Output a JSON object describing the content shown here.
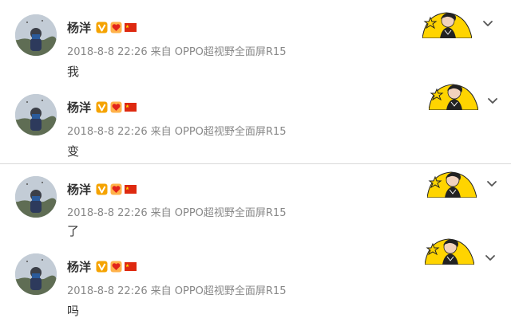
{
  "posts": [
    {
      "username": "杨洋",
      "timestamp": "2018-8-8 22:26",
      "source": "来自 OPPO超视野全面屏R15",
      "text": "我",
      "badges": [
        "verified-v-icon",
        "fan-heart-icon",
        "china-flag-icon"
      ],
      "menu_icon": "chevron-down-icon"
    },
    {
      "username": "杨洋",
      "timestamp": "2018-8-8 22:26",
      "source": "来自 OPPO超视野全面屏R15",
      "text": "变",
      "badges": [
        "verified-v-icon",
        "fan-heart-icon",
        "china-flag-icon"
      ],
      "menu_icon": "chevron-down-icon"
    },
    {
      "username": "杨洋",
      "timestamp": "2018-8-8 22:26",
      "source": "来自 OPPO超视野全面屏R15",
      "text": "了",
      "badges": [
        "verified-v-icon",
        "fan-heart-icon",
        "china-flag-icon"
      ],
      "menu_icon": "chevron-down-icon"
    },
    {
      "username": "杨洋",
      "timestamp": "2018-8-8 22:26",
      "source": "来自 OPPO超视野全面屏R15",
      "text": "吗",
      "badges": [
        "verified-v-icon",
        "fan-heart-icon",
        "china-flag-icon"
      ],
      "menu_icon": "chevron-down-icon"
    }
  ],
  "colors": {
    "username": "#333333",
    "meta": "#888888",
    "verified_badge": "#f5a300",
    "flag_red": "#de2910",
    "flag_star": "#ffde00",
    "sticker_yellow": "#ffd400",
    "divider": "#d9d9d9"
  }
}
